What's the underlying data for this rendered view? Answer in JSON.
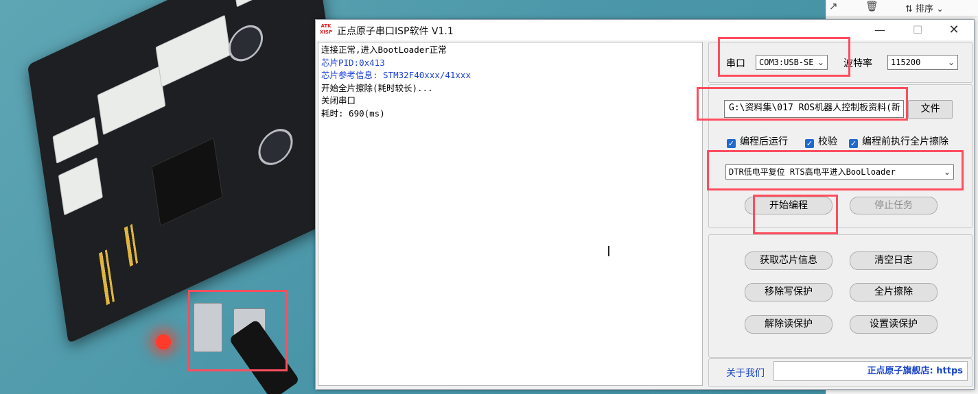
{
  "window": {
    "title": "正点原子串口ISP软件 V1.1",
    "icon_text_1": "ATK",
    "icon_text_2": "XISP",
    "minimize_glyph": "—",
    "maximize_glyph": "☐",
    "close_glyph": "✕"
  },
  "log": {
    "lines": [
      {
        "text": "连接正常,进入BootLoader正常",
        "color": "black"
      },
      {
        "text": "芯片PID:0x413",
        "color": "blue"
      },
      {
        "text": "芯片参考信息: STM32F40xxx/41xxx",
        "color": "blue"
      },
      {
        "text": "开始全片擦除(耗时较长)...",
        "color": "black"
      },
      {
        "text": "关闭串口",
        "color": "black"
      },
      {
        "text": "耗时: 690(ms)",
        "color": "black"
      }
    ]
  },
  "serial": {
    "port_label": "串口",
    "port_value": "COM3:USB-SE",
    "baud_label": "波特率",
    "baud_value": "115200"
  },
  "file": {
    "path_value": "G:\\资料集\\017 ROS机器人控制板资料(新",
    "file_button": "文件"
  },
  "options": {
    "run_after": "编程后运行",
    "verify": "校验",
    "erase_before": "编程前执行全片擦除",
    "reset_mode": "DTR低电平复位 RTS高电平进入BooLloader"
  },
  "actions": {
    "start": "开始编程",
    "stop": "停止任务",
    "get_info": "获取芯片信息",
    "clear_log": "清空日志",
    "remove_wp": "移除写保护",
    "full_erase": "全片擦除",
    "remove_rp": "解除读保护",
    "set_rp": "设置读保护"
  },
  "footer": {
    "about": "关于我们",
    "store": "正点原子旗舰店: https"
  },
  "explorer": {
    "sort_label": "排序"
  },
  "colors": {
    "highlight": "#ff4d5e",
    "checkbox": "#1f6ad1",
    "log_blue": "#1a3fd8"
  }
}
